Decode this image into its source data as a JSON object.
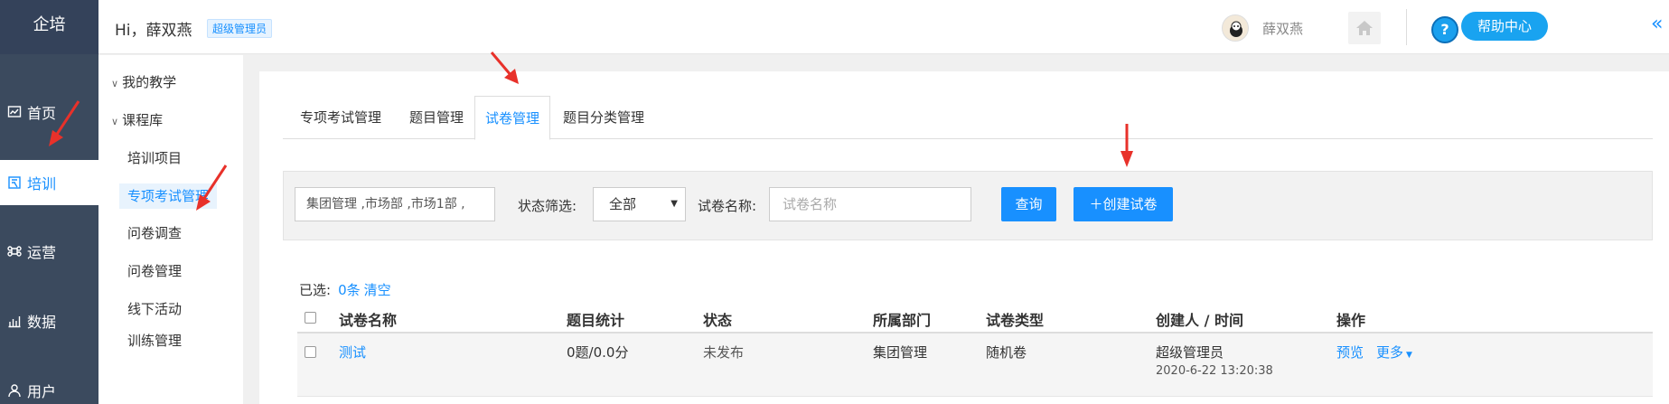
{
  "app": {
    "brand": "企培"
  },
  "nav": [
    {
      "label": "首页",
      "icon": "dashboard-icon",
      "active": false
    },
    {
      "label": "培训",
      "icon": "book-icon",
      "active": true
    },
    {
      "label": "运营",
      "icon": "command-icon",
      "active": false
    },
    {
      "label": "数据",
      "icon": "bar-chart-icon",
      "active": false
    },
    {
      "label": "用户",
      "icon": "user-icon",
      "active": false
    }
  ],
  "header": {
    "greeting": "Hi，薛双燕",
    "role_badge": "超级管理员",
    "user_name": "薛双燕",
    "help_label": "帮助中心",
    "help_icon": "?"
  },
  "subnav": {
    "groups": [
      "我的教学",
      "课程库"
    ],
    "items": [
      "培训项目",
      "专项考试管理",
      "问卷调查",
      "问卷管理",
      "线下活动",
      "训练管理"
    ]
  },
  "tabs": [
    "专项考试管理",
    "题目管理",
    "试卷管理",
    "题目分类管理"
  ],
  "filter": {
    "dept_value": "集团管理 ,市场部 ,市场1部 ,",
    "status_label": "状态筛选:",
    "status_value": "全部",
    "name_label": "试卷名称:",
    "name_placeholder": "试卷名称",
    "query_label": "查询",
    "create_label": "＋创建试卷"
  },
  "selection": {
    "prefix": "已选:",
    "count": "0条",
    "clear": "清空"
  },
  "table": {
    "headers": [
      "试卷名称",
      "题目统计",
      "状态",
      "所属部门",
      "试卷类型",
      "创建人 / 时间",
      "操作"
    ],
    "rows": [
      {
        "name": "测试",
        "stats": "0题/0.0分",
        "status": "未发布",
        "dept": "集团管理",
        "type": "随机卷",
        "creator": "超级管理员",
        "time": "2020-6-22 13:20:38",
        "preview": "预览",
        "more": "更多"
      }
    ]
  },
  "colors": {
    "accent": "#1890ff",
    "sidebar": "#3b4a5e",
    "arrow": "#e8312a"
  }
}
